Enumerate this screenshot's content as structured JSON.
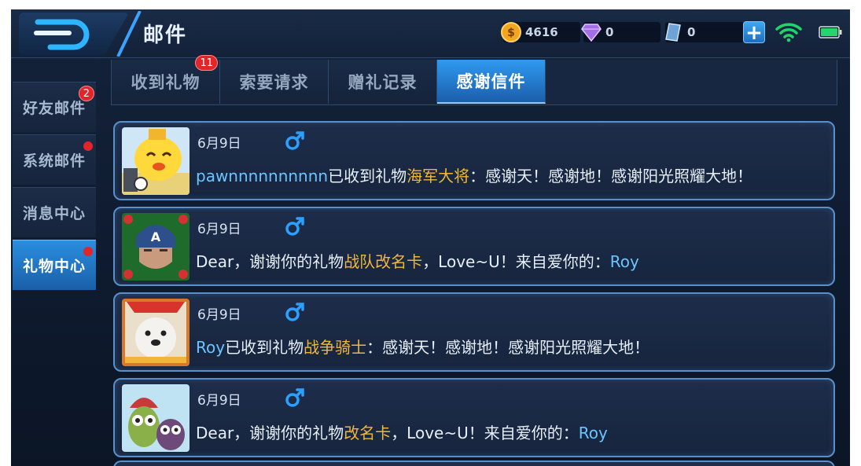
{
  "header": {
    "title": "邮件",
    "currencies": {
      "gold": {
        "icon": "gold-coin-icon",
        "value": "4616"
      },
      "gem": {
        "icon": "purple-diamond-icon",
        "value": "0"
      },
      "voucher": {
        "icon": "blue-crystal-icon",
        "value": "0"
      }
    },
    "plus_label": "+"
  },
  "sidebar": {
    "items": [
      {
        "label": "好友邮件",
        "badge": "2",
        "dot": false,
        "active": false
      },
      {
        "label": "系统邮件",
        "badge": "",
        "dot": true,
        "active": false
      },
      {
        "label": "消息中心",
        "badge": "",
        "dot": false,
        "active": false
      },
      {
        "label": "礼物中心",
        "badge": "",
        "dot": true,
        "active": true
      }
    ]
  },
  "tabs": [
    {
      "label": "收到礼物",
      "badge": "11",
      "active": false
    },
    {
      "label": "索要请求",
      "badge": "",
      "active": false
    },
    {
      "label": "赠礼记录",
      "badge": "",
      "active": false
    },
    {
      "label": "感谢信件",
      "badge": "",
      "active": true
    }
  ],
  "messages": [
    {
      "date": "6月9日",
      "gender": "male",
      "avatar": "cartoon-chick-avatar",
      "pre": "",
      "name1": "pawnnnnnnnnnn",
      "mid": "已收到礼物",
      "gift": "海军大将",
      "post": "：感谢天！感谢地！感谢阳光照耀大地！",
      "name2": ""
    },
    {
      "date": "6月9日",
      "gender": "male",
      "avatar": "captain-hero-avatar",
      "pre": "Dear，谢谢你的礼物",
      "name1": "",
      "mid": "",
      "gift": "战队改名卡",
      "post": "，Love~U！来自爱你的：",
      "name2": "Roy"
    },
    {
      "date": "6月9日",
      "gender": "male",
      "avatar": "white-dog-avatar",
      "pre": "",
      "name1": "Roy",
      "mid": "已收到礼物",
      "gift": "战争骑士",
      "post": "：感谢天！感谢地！感谢阳光照耀大地！",
      "name2": ""
    },
    {
      "date": "6月9日",
      "gender": "male",
      "avatar": "owls-avatar",
      "pre": "Dear，谢谢你的礼物",
      "name1": "",
      "mid": "",
      "gift": "改名卡",
      "post": "，Love~U！来自爱你的：",
      "name2": "Roy"
    }
  ],
  "colors": {
    "name": "#6cc4ff",
    "gift": "#f0b63c",
    "active_tab": "#2f9af0",
    "badge": "#e0252b"
  }
}
